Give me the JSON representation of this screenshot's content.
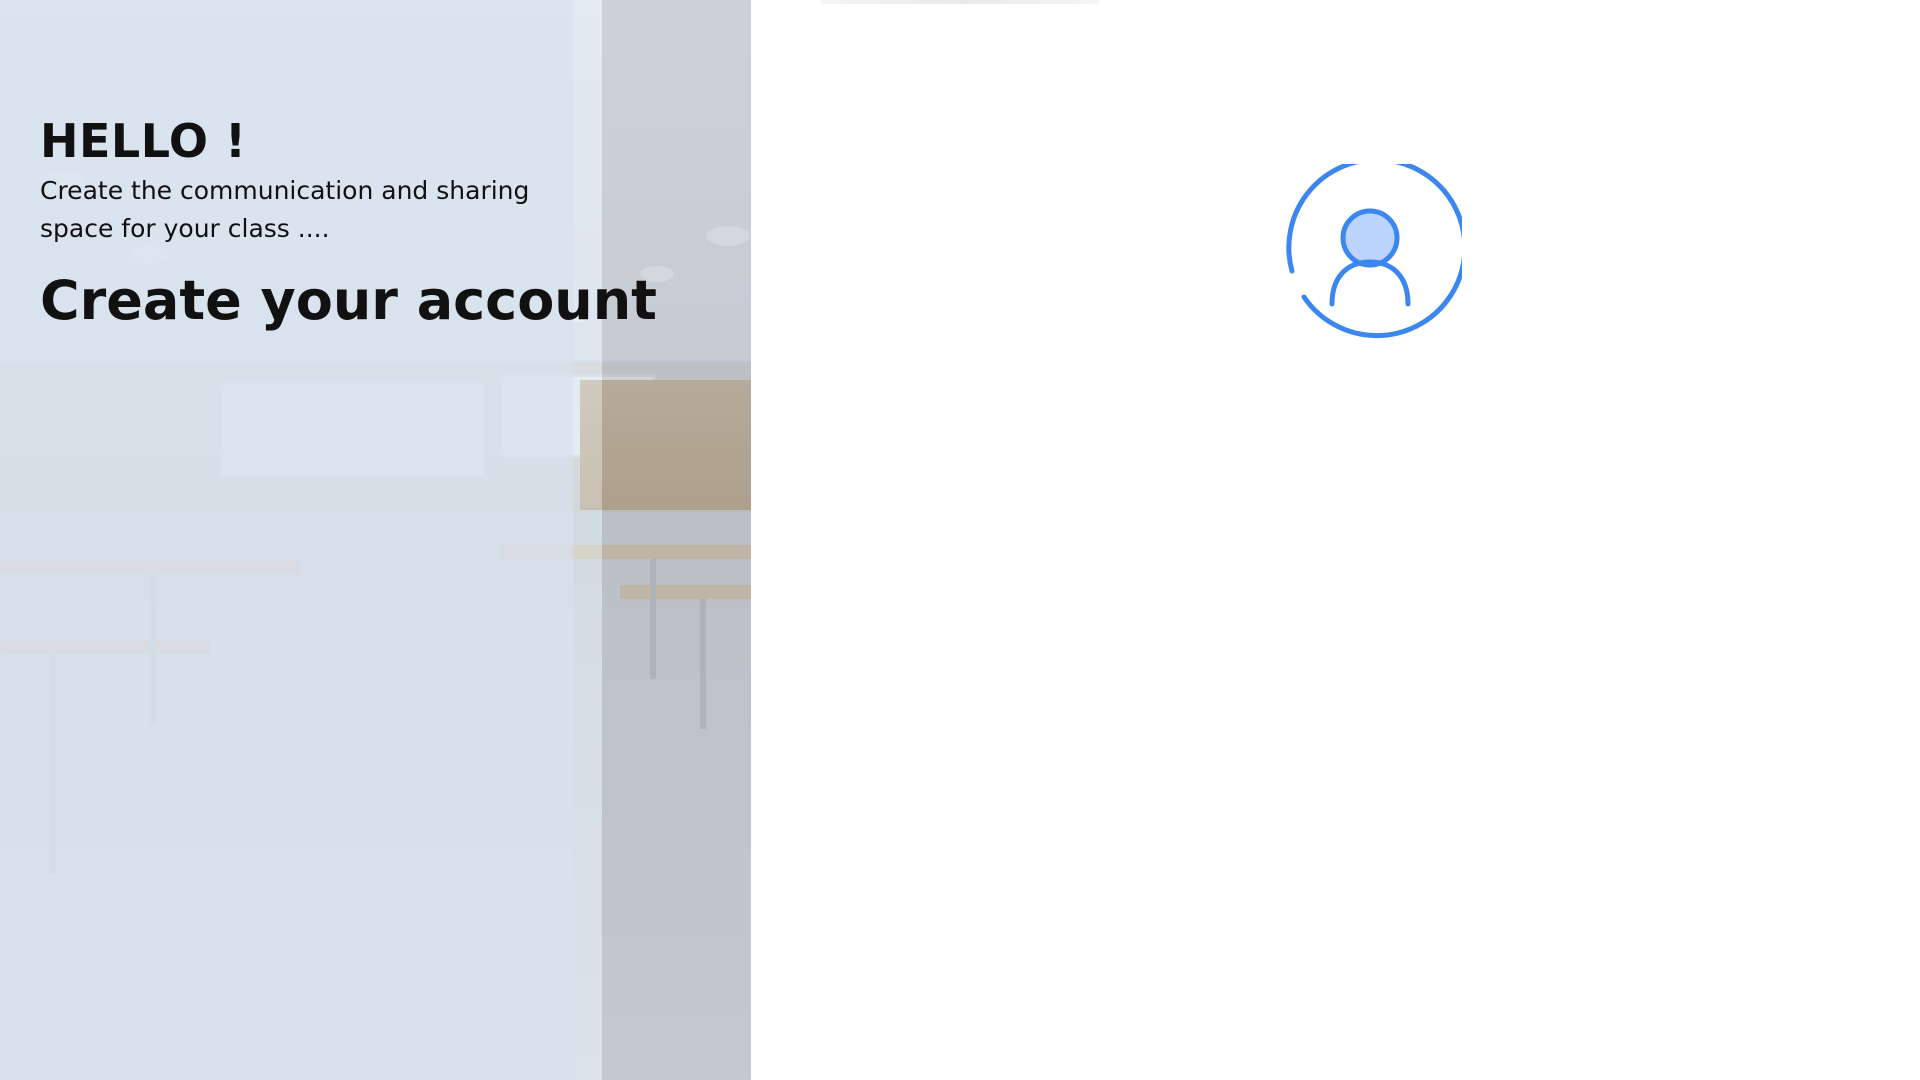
{
  "hero": {
    "greeting": "HELLO !",
    "subtitle": "Create the communication and sharing space for your class ....",
    "heading": "Create your account",
    "background_image": "empty classroom with desks and whiteboards"
  },
  "profile": {
    "icon": "user-avatar-icon",
    "accent_color": "#3b87ef",
    "fill_color": "#bcd4fb"
  },
  "colors": {
    "panel_tint": "#d6e2ee",
    "text": "#111111",
    "background": "#ffffff"
  }
}
